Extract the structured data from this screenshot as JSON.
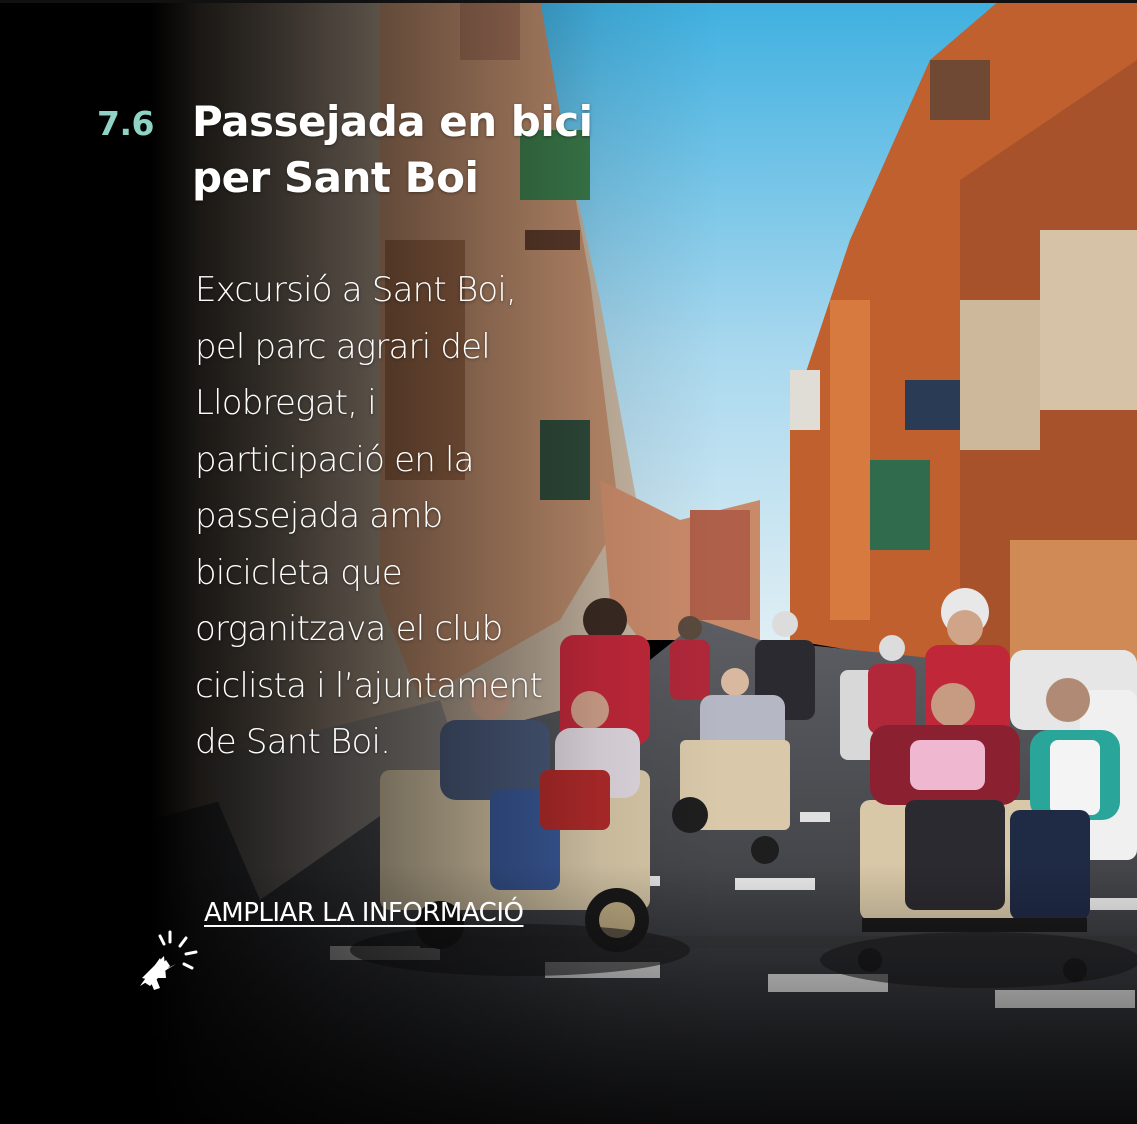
{
  "slide": {
    "number": "7.6",
    "title_lines": [
      "Passejada en bici",
      "per Sant Boi"
    ],
    "description_lines": [
      "Excursió a Sant Boi,",
      "pel parc agrari del",
      "Llobregat, i",
      "participació en la",
      "passejada amb",
      "bicicleta que",
      "organitzava el club",
      "ciclista i l’ajuntament",
      "de Sant Boi."
    ],
    "more_link_label": "AMPLIAR LA INFORMACIÓ",
    "cursor_icon": "pointer-click-icon"
  },
  "colors": {
    "accent": "#8fd3c4",
    "text": "#ffffff",
    "background": "#000000"
  }
}
